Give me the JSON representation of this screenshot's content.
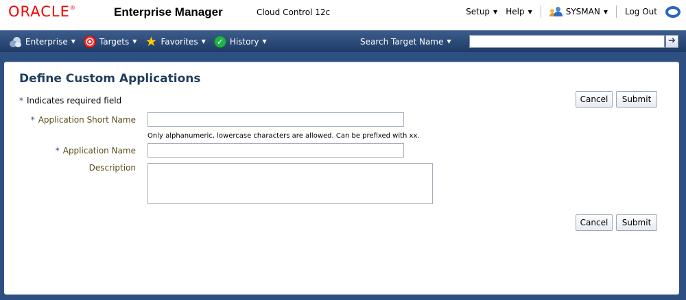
{
  "brand": {
    "logo": "ORACLE",
    "title": "Enterprise Manager",
    "subtitle": "Cloud Control 12c"
  },
  "global_links": {
    "setup": "Setup",
    "help": "Help",
    "user": "SYSMAN",
    "logout": "Log Out"
  },
  "nav": {
    "items": [
      {
        "label": "Enterprise",
        "icon": "enterprise-cloud-icon"
      },
      {
        "label": "Targets",
        "icon": "target-icon"
      },
      {
        "label": "Favorites",
        "icon": "star-icon"
      },
      {
        "label": "History",
        "icon": "history-icon"
      }
    ],
    "search_label": "Search Target Name",
    "search_value": ""
  },
  "page": {
    "title": "Define Custom Applications",
    "required_note": "Indicates required field",
    "required_marker": "*",
    "cancel_label": "Cancel",
    "submit_label": "Submit"
  },
  "form": {
    "short_name_label": "Application Short Name",
    "short_name_value": "",
    "short_name_hint": "Only alphanumeric, lowercase characters are allowed. Can be prefixed with xx.",
    "app_name_label": "Application Name",
    "app_name_value": "",
    "description_label": "Description",
    "description_value": ""
  },
  "colors": {
    "brand_red": "#f80000",
    "nav_blue": "#2d4f82",
    "title_blue": "#1f3e5c",
    "label_olive": "#5b4a16"
  }
}
